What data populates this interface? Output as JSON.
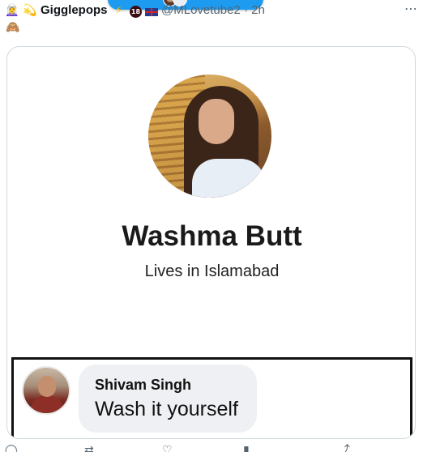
{
  "header": {
    "leading_emoji": "🧝‍♀️",
    "name_emoji": "💫",
    "display_name": "Gigglepops",
    "lightning_emoji": "⚡",
    "badge": "18",
    "handle": "@MLovetube2 · 2h",
    "more_icon": "⋯",
    "second_line_emoji": "🙈"
  },
  "card": {
    "profile_name": "Washma Butt",
    "profile_location": "Lives in Islamabad",
    "comment": {
      "author": "Shivam Singh",
      "text": "Wash it yourself"
    }
  },
  "actions": {
    "reply_icon": "◯",
    "retweet_icon": "⇄",
    "like_icon": "♡",
    "views_icon": "▮",
    "share_icon": "⤴"
  },
  "colors": {
    "accent": "#1d9bf0",
    "secondary_text": "#536471",
    "border": "#cfd9de"
  }
}
